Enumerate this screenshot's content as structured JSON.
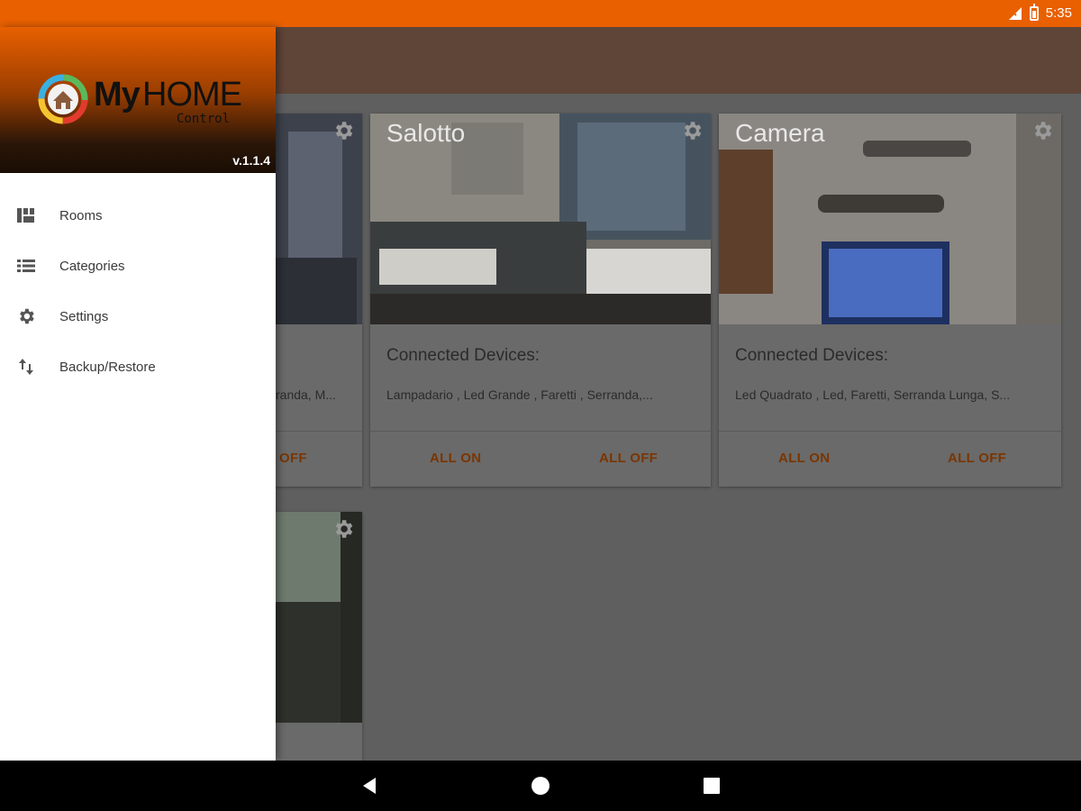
{
  "status_bar": {
    "time": "5:35"
  },
  "drawer": {
    "logo_my": "My",
    "logo_home": "HOME",
    "logo_control": "Control",
    "version": "v.1.1.4",
    "items": [
      {
        "label": "Rooms",
        "icon": "rooms-icon"
      },
      {
        "label": "Categories",
        "icon": "list-icon"
      },
      {
        "label": "Settings",
        "icon": "gear-icon"
      },
      {
        "label": "Backup/Restore",
        "icon": "swap-vertical-icon"
      }
    ]
  },
  "rooms": [
    {
      "title": "",
      "subtitle": "",
      "devices": "randa, M...",
      "btn_on": "",
      "btn_off": "OFF"
    },
    {
      "title": "Salotto",
      "subtitle": "Connected Devices:",
      "devices": "Lampadario , Led Grande , Faretti , Serranda,...",
      "btn_on": "ALL ON",
      "btn_off": "ALL OFF"
    },
    {
      "title": "Camera",
      "subtitle": "Connected Devices:",
      "devices": "Led Quadrato , Led, Faretti, Serranda Lunga, S...",
      "btn_on": "ALL ON",
      "btn_off": "ALL OFF"
    }
  ],
  "fab": {
    "label": "+"
  },
  "colors": {
    "status_bar": "#e86000",
    "accent": "#e86000",
    "fab": "#c0392b"
  }
}
